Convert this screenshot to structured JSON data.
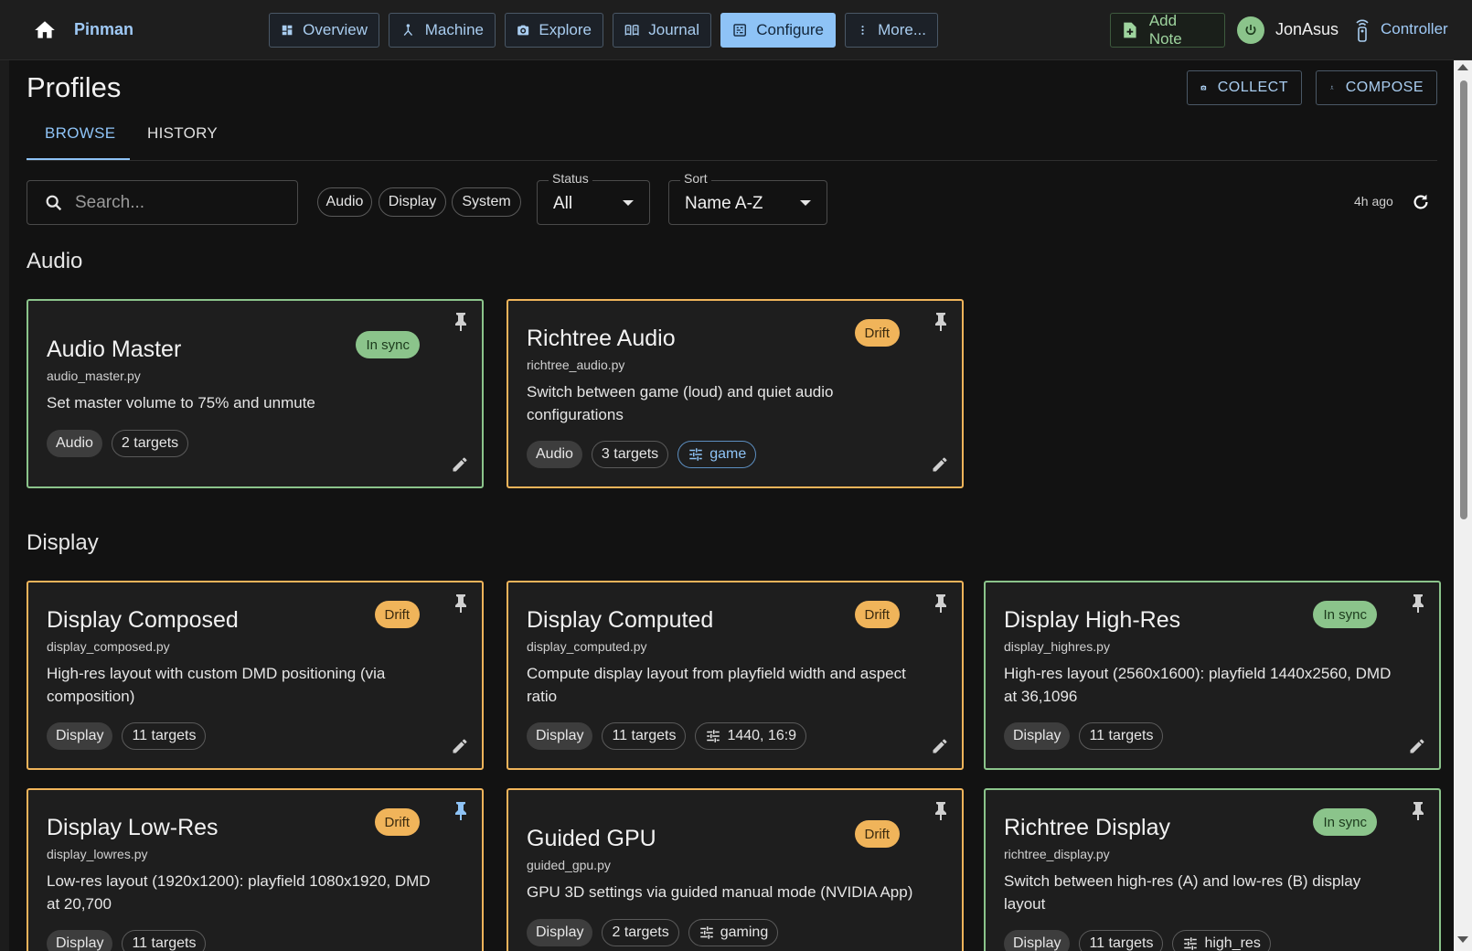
{
  "app": {
    "title": "Pinman"
  },
  "nav": [
    {
      "label": "Overview",
      "icon": "dashboard-icon"
    },
    {
      "label": "Machine",
      "icon": "hub-icon"
    },
    {
      "label": "Explore",
      "icon": "camera-icon"
    },
    {
      "label": "Journal",
      "icon": "book-icon"
    },
    {
      "label": "Configure",
      "icon": "settings-panel-icon",
      "active": true
    },
    {
      "label": "More...",
      "icon": "more-vert-icon"
    }
  ],
  "header_right": {
    "add_note": "Add Note",
    "user": "JonAsus",
    "controller": "Controller"
  },
  "page": {
    "title": "Profiles",
    "actions": {
      "collect": "COLLECT",
      "compose": "COMPOSE"
    },
    "tabs": [
      {
        "label": "BROWSE",
        "active": true
      },
      {
        "label": "HISTORY"
      }
    ],
    "search_placeholder": "Search...",
    "category_chips": [
      "Audio",
      "Display",
      "System"
    ],
    "status_filter": {
      "label": "Status",
      "value": "All"
    },
    "sort_filter": {
      "label": "Sort",
      "value": "Name A-Z"
    },
    "updated": "4h ago"
  },
  "sections": [
    {
      "name": "Audio",
      "cards": [
        {
          "title": "Audio Master",
          "file": "audio_master.py",
          "status": "In sync",
          "description": "Set master volume to 75% and unmute",
          "category": "Audio",
          "targets": "2 targets"
        },
        {
          "title": "Richtree Audio",
          "file": "richtree_audio.py",
          "status": "Drift",
          "description": "Switch between game (loud) and quiet audio configurations",
          "category": "Audio",
          "targets": "3 targets",
          "param": "game"
        }
      ]
    },
    {
      "name": "Display",
      "cards": [
        {
          "title": "Display Composed",
          "file": "display_composed.py",
          "status": "Drift",
          "description": "High-res layout with custom DMD positioning (via composition)",
          "category": "Display",
          "targets": "11 targets"
        },
        {
          "title": "Display Computed",
          "file": "display_computed.py",
          "status": "Drift",
          "description": "Compute display layout from playfield width and aspect ratio",
          "category": "Display",
          "targets": "11 targets",
          "param": "1440, 16:9"
        },
        {
          "title": "Display High-Res",
          "file": "display_highres.py",
          "status": "In sync",
          "description": "High-res layout (2560x1600): playfield 1440x2560, DMD at 36,1096",
          "category": "Display",
          "targets": "11 targets"
        },
        {
          "title": "Display Low-Res",
          "file": "display_lowres.py",
          "status": "Drift",
          "description": "Low-res layout (1920x1200): playfield 1080x1920, DMD at 20,700",
          "category": "Display",
          "targets": "11 targets"
        },
        {
          "title": "Guided GPU",
          "file": "guided_gpu.py",
          "status": "Drift",
          "description": "GPU 3D settings via guided manual mode (NVIDIA App)",
          "category": "Display",
          "targets": "2 targets",
          "param": "gaming"
        },
        {
          "title": "Richtree Display",
          "file": "richtree_display.py",
          "status": "In sync",
          "description": "Switch between high-res (A) and low-res (B) display layout",
          "category": "Display",
          "targets": "11 targets",
          "param": "high_res"
        }
      ]
    }
  ],
  "colors": {
    "accent": "#8ec3f6",
    "sync": "#8bc48b",
    "drift": "#f0b45a",
    "background": "#121212",
    "surface": "#1e1e1e"
  }
}
